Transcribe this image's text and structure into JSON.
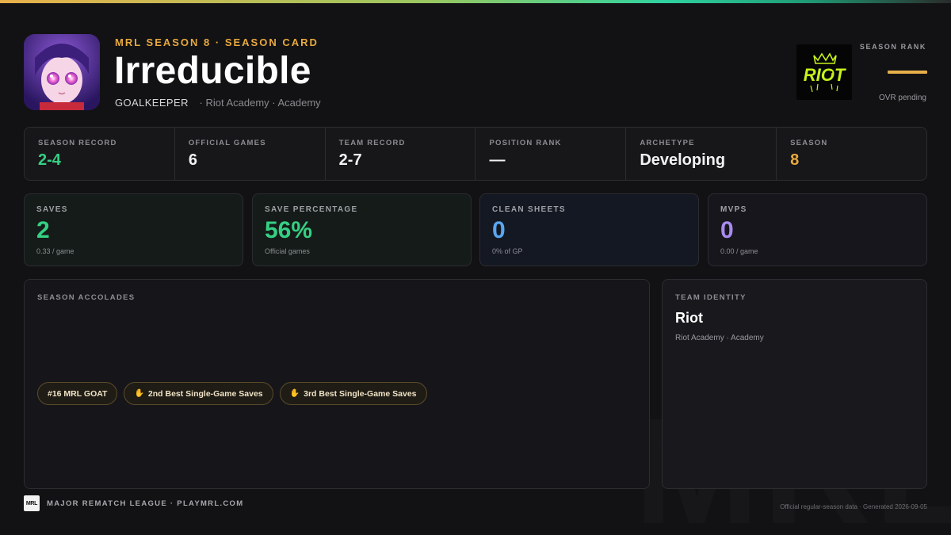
{
  "header": {
    "eyebrow": "MRL SEASON 8 · SEASON CARD",
    "player_name": "Irreducible",
    "position": "GOALKEEPER",
    "team_line": "· Riot Academy · Academy",
    "avatar_icon": "anime-avatar-image",
    "team_logo_text": "RIOT"
  },
  "rank": {
    "label": "SEASON RANK",
    "value_icon": "dash",
    "sub": "OVR pending"
  },
  "strip": [
    {
      "label": "SEASON RECORD",
      "value": "2-4"
    },
    {
      "label": "OFFICIAL GAMES",
      "value": "6"
    },
    {
      "label": "TEAM RECORD",
      "value": "2-7"
    },
    {
      "label": "POSITION RANK",
      "value": "—"
    },
    {
      "label": "ARCHETYPE",
      "value": "Developing"
    },
    {
      "label": "SEASON",
      "value": "8"
    }
  ],
  "cards": [
    {
      "label": "SAVES",
      "value": "2",
      "note": "0.33 / game",
      "accent": "#35cf83"
    },
    {
      "label": "SAVE PERCENTAGE",
      "value": "56%",
      "note": "Official games",
      "accent": "#35cf83"
    },
    {
      "label": "CLEAN SHEETS",
      "value": "0",
      "note": "0% of GP",
      "accent": "#5aa6f0"
    },
    {
      "label": "MVPS",
      "value": "0",
      "note": "0.00 / game",
      "accent": "#a78bf0"
    }
  ],
  "accolades": {
    "label": "SEASON ACCOLADES",
    "items": [
      {
        "text": "#16 MRL GOAT",
        "icon": ""
      },
      {
        "text": "2nd Best Single-Game Saves",
        "icon": "glove-icon"
      },
      {
        "text": "3rd Best Single-Game Saves",
        "icon": "glove-icon"
      }
    ]
  },
  "team_identity": {
    "label": "TEAM IDENTITY",
    "name": "Riot",
    "sub": "Riot Academy · Academy"
  },
  "footer": {
    "logo_text": "MRL",
    "league": "MAJOR REMATCH LEAGUE · PLAYMRL.COM",
    "note": "Official regular-season data · Generated 2026-09-05",
    "watermark": "MRL"
  },
  "colors": {
    "gold": "#e8a93f",
    "green": "#35cf83",
    "blue": "#5aa6f0",
    "purple": "#a78bf0",
    "logo_neon": "#c6f21a"
  }
}
